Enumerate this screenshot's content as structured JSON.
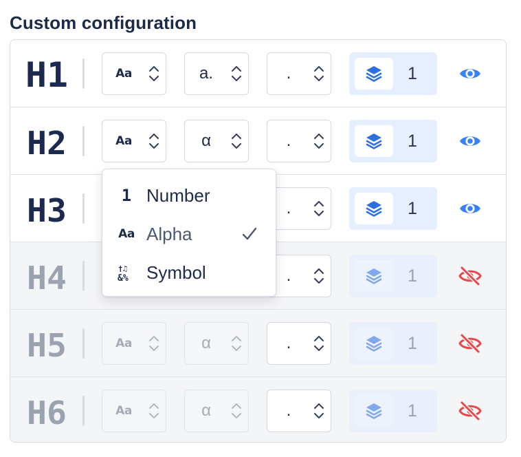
{
  "title": "Custom configuration",
  "rows": [
    {
      "label": "H1",
      "style_value": "Aa",
      "format_value": "a.",
      "separator_value": ".",
      "level": "1",
      "visible": true
    },
    {
      "label": "H2",
      "style_value": "Aa",
      "format_value": "α",
      "separator_value": ".",
      "level": "1",
      "visible": true
    },
    {
      "label": "H3",
      "style_value": "",
      "format_value": "",
      "separator_value": ".",
      "level": "1",
      "visible": true
    },
    {
      "label": "H4",
      "style_value": "",
      "format_value": "",
      "separator_value": ".",
      "level": "1",
      "visible": false
    },
    {
      "label": "H5",
      "style_value": "Aa",
      "format_value": "α",
      "separator_value": ".",
      "level": "1",
      "visible": false
    },
    {
      "label": "H6",
      "style_value": "Aa",
      "format_value": "α",
      "separator_value": ".",
      "level": "1",
      "visible": false
    }
  ],
  "dropdown": {
    "items": [
      {
        "icon": "number-1-icon",
        "icon_text": "1",
        "label": "Number",
        "selected": false
      },
      {
        "icon": "alpha-aa-icon",
        "icon_text": "Aa",
        "label": "Alpha",
        "selected": true
      },
      {
        "icon": "symbol-icon",
        "icon_text": "",
        "label": "Symbol",
        "selected": false
      }
    ]
  },
  "colors": {
    "heading_active": "#1c2a4f",
    "heading_disabled": "#9ba3b0",
    "accent_blue": "#2e6fe0",
    "eye_visible": "#3b82f6",
    "eye_hidden": "#e5484d",
    "layer_bg": "#e6efff"
  }
}
